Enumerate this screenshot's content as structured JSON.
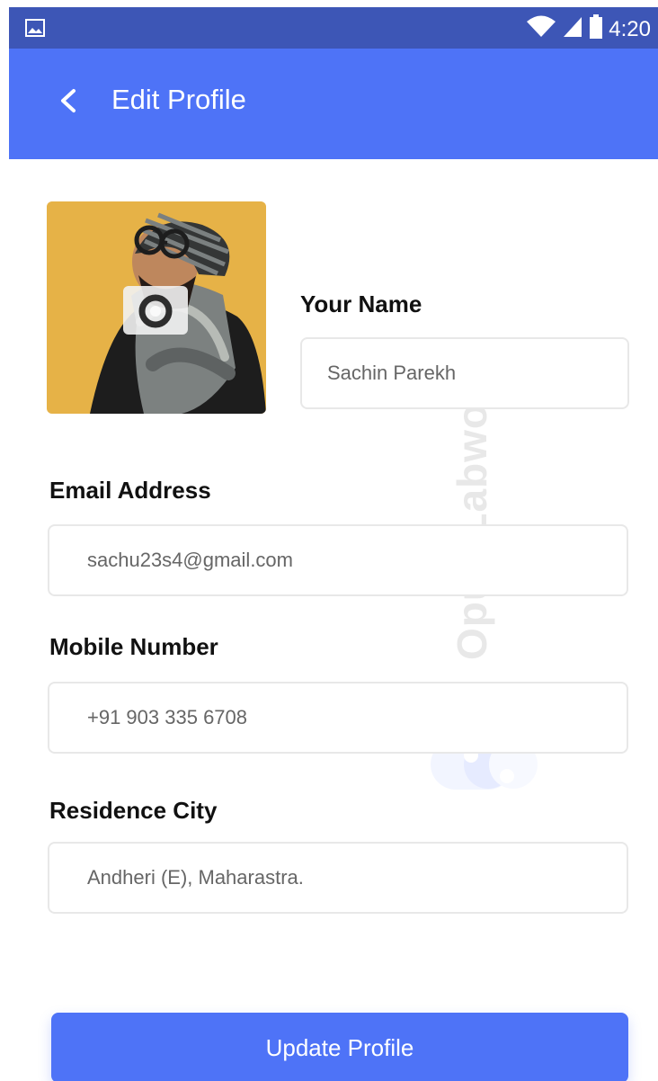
{
  "status_bar": {
    "time": "4:20",
    "icons": [
      "image-icon",
      "wifi-icon",
      "signal-icon",
      "battery-icon"
    ],
    "background": "#3d56b6"
  },
  "app_bar": {
    "title": "Edit Profile",
    "back_icon": "chevron-left-icon",
    "background": "#4e73f7"
  },
  "profile": {
    "camera_icon": "camera-icon",
    "name_label": "Your Name",
    "name_value": "Sachin Parekh"
  },
  "form": {
    "email": {
      "label": "Email Address",
      "value": "sachu23s4@gmail.com"
    },
    "mobile": {
      "label": "Mobile Number",
      "value": "+91 903 335 6708"
    },
    "city": {
      "label": "Residence City",
      "value": "Andheri (E), Maharastra."
    }
  },
  "actions": {
    "update_label": "Update Profile",
    "accent": "#4e73f7"
  },
  "watermark": {
    "text": "Opus Labworks"
  }
}
